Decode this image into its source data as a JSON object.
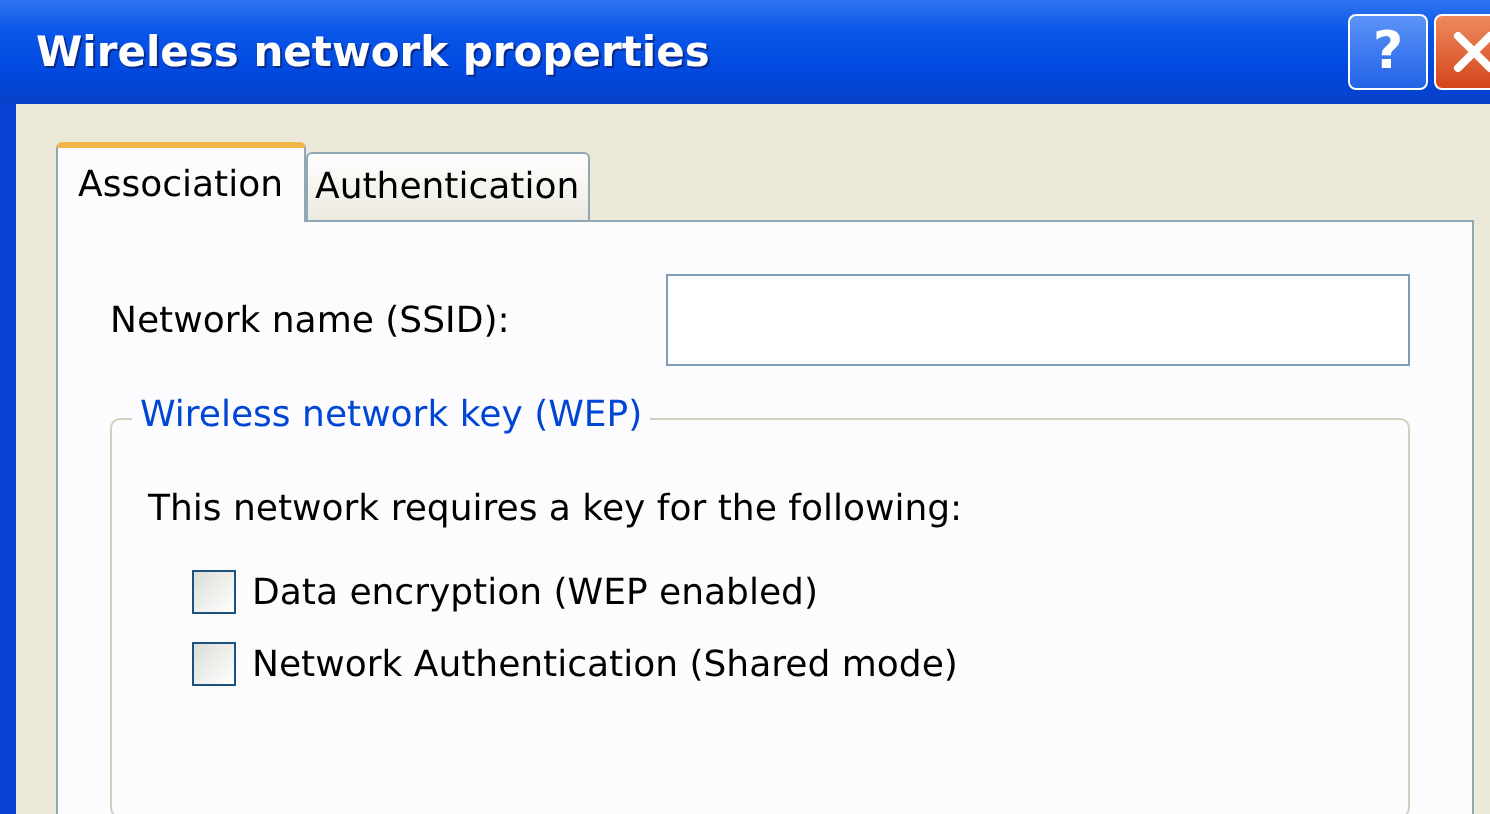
{
  "window": {
    "title": "Wireless network properties",
    "help_button": "?"
  },
  "tabs": [
    {
      "label": "Association",
      "selected": true
    },
    {
      "label": "Authentication",
      "selected": false
    }
  ],
  "ssid": {
    "label": "Network name (SSID):"
  },
  "group": {
    "title": "Wireless network key (WEP)",
    "text": "This network requires a key for the following:",
    "options": [
      {
        "label": "Data encryption (WEP enabled)",
        "checked": false
      },
      {
        "label": "Network Authentication (Shared mode)",
        "checked": false
      }
    ]
  }
}
